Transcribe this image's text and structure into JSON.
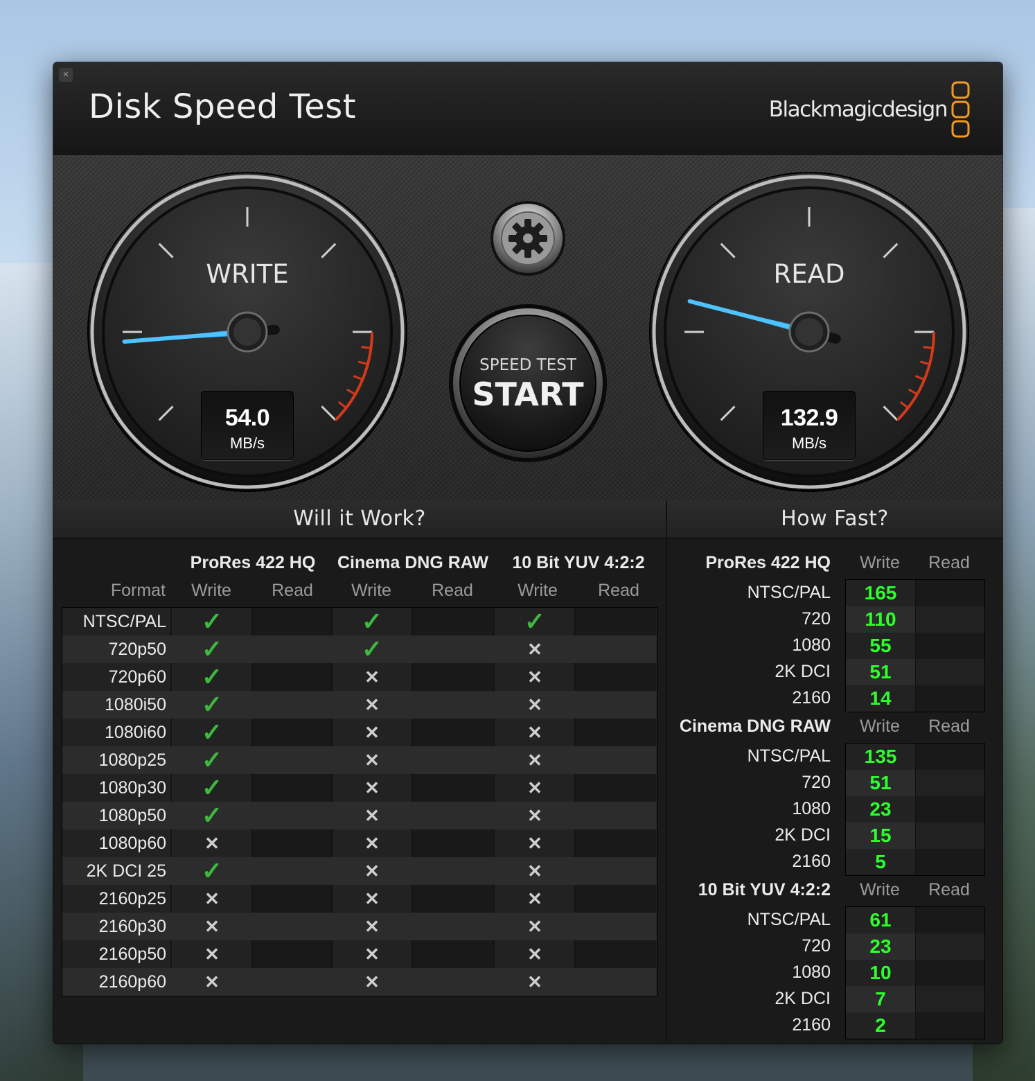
{
  "window": {
    "close_label": "×",
    "title": "Disk Speed Test",
    "brand": "Blackmagicdesign",
    "accent_color": "#f29a1e"
  },
  "gauges": {
    "write": {
      "label": "WRITE",
      "value": "54.0",
      "unit": "MB/s",
      "needle_fraction": 0.15
    },
    "read": {
      "label": "READ",
      "value": "132.9",
      "unit": "MB/s",
      "needle_fraction": 0.22
    }
  },
  "start_button": {
    "subtitle": "SPEED TEST",
    "label": "START"
  },
  "settings_button": {
    "icon": "gear-icon"
  },
  "will_it_work": {
    "title": "Will it Work?",
    "format_header": "Format",
    "groups": [
      "ProRes 422 HQ",
      "Cinema DNG RAW",
      "10 Bit YUV 4:2:2"
    ],
    "sub_headers": [
      "Write",
      "Read"
    ],
    "rows": [
      {
        "format": "NTSC/PAL",
        "marks": [
          "check",
          "",
          "check",
          "",
          "check",
          ""
        ]
      },
      {
        "format": "720p50",
        "marks": [
          "check",
          "",
          "check",
          "",
          "x",
          ""
        ]
      },
      {
        "format": "720p60",
        "marks": [
          "check",
          "",
          "x",
          "",
          "x",
          ""
        ]
      },
      {
        "format": "1080i50",
        "marks": [
          "check",
          "",
          "x",
          "",
          "x",
          ""
        ]
      },
      {
        "format": "1080i60",
        "marks": [
          "check",
          "",
          "x",
          "",
          "x",
          ""
        ]
      },
      {
        "format": "1080p25",
        "marks": [
          "check",
          "",
          "x",
          "",
          "x",
          ""
        ]
      },
      {
        "format": "1080p30",
        "marks": [
          "check",
          "",
          "x",
          "",
          "x",
          ""
        ]
      },
      {
        "format": "1080p50",
        "marks": [
          "check",
          "",
          "x",
          "",
          "x",
          ""
        ]
      },
      {
        "format": "1080p60",
        "marks": [
          "x",
          "",
          "x",
          "",
          "x",
          ""
        ]
      },
      {
        "format": "2K DCI 25",
        "marks": [
          "check",
          "",
          "x",
          "",
          "x",
          ""
        ]
      },
      {
        "format": "2160p25",
        "marks": [
          "x",
          "",
          "x",
          "",
          "x",
          ""
        ]
      },
      {
        "format": "2160p30",
        "marks": [
          "x",
          "",
          "x",
          "",
          "x",
          ""
        ]
      },
      {
        "format": "2160p50",
        "marks": [
          "x",
          "",
          "x",
          "",
          "x",
          ""
        ]
      },
      {
        "format": "2160p60",
        "marks": [
          "x",
          "",
          "x",
          "",
          "x",
          ""
        ]
      }
    ]
  },
  "how_fast": {
    "title": "How Fast?",
    "col_write": "Write",
    "col_read": "Read",
    "groups": [
      {
        "name": "ProRes 422 HQ",
        "rows": [
          {
            "label": "NTSC/PAL",
            "write": "165",
            "read": ""
          },
          {
            "label": "720",
            "write": "110",
            "read": ""
          },
          {
            "label": "1080",
            "write": "55",
            "read": ""
          },
          {
            "label": "2K DCI",
            "write": "51",
            "read": ""
          },
          {
            "label": "2160",
            "write": "14",
            "read": ""
          }
        ]
      },
      {
        "name": "Cinema DNG RAW",
        "rows": [
          {
            "label": "NTSC/PAL",
            "write": "135",
            "read": ""
          },
          {
            "label": "720",
            "write": "51",
            "read": ""
          },
          {
            "label": "1080",
            "write": "23",
            "read": ""
          },
          {
            "label": "2K DCI",
            "write": "15",
            "read": ""
          },
          {
            "label": "2160",
            "write": "5",
            "read": ""
          }
        ]
      },
      {
        "name": "10 Bit YUV 4:2:2",
        "rows": [
          {
            "label": "NTSC/PAL",
            "write": "61",
            "read": ""
          },
          {
            "label": "720",
            "write": "23",
            "read": ""
          },
          {
            "label": "1080",
            "write": "10",
            "read": ""
          },
          {
            "label": "2K DCI",
            "write": "7",
            "read": ""
          },
          {
            "label": "2160",
            "write": "2",
            "read": ""
          }
        ]
      }
    ]
  }
}
